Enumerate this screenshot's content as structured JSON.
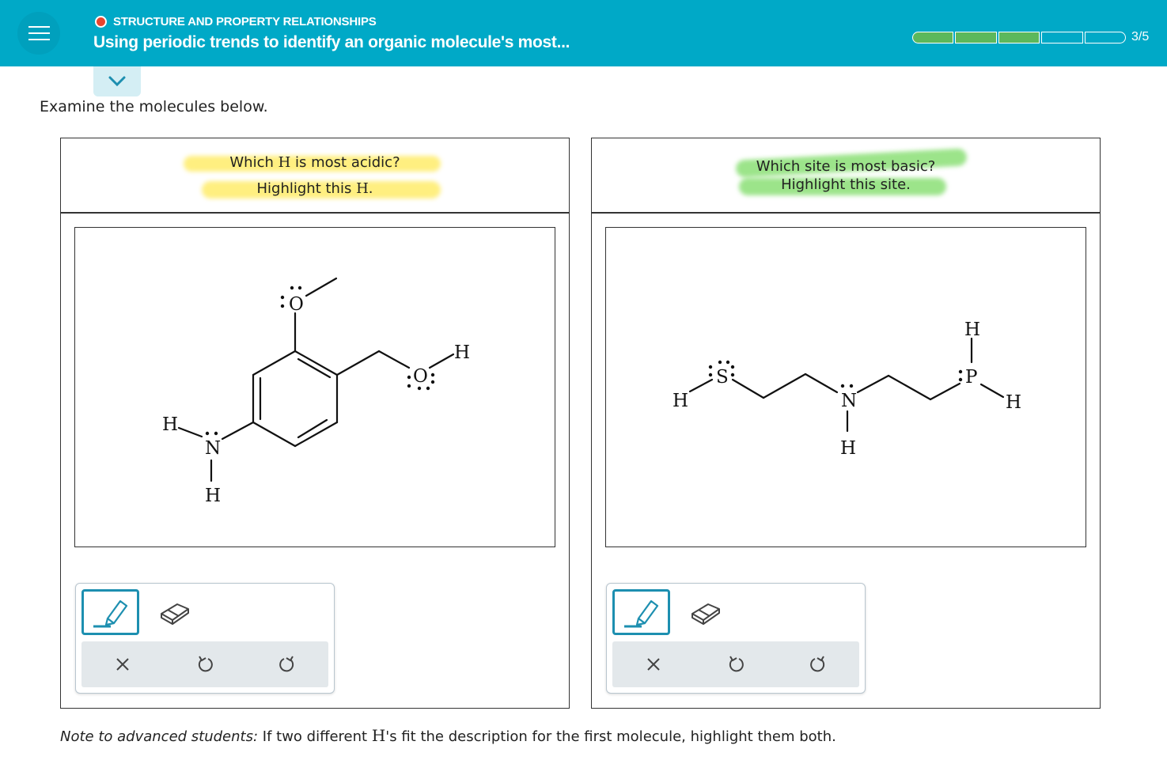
{
  "header": {
    "topic": "STRUCTURE AND PROPERTY RELATIONSHIPS",
    "title": "Using periodic trends to identify an organic molecule's most...",
    "progress_text": "3/5",
    "progress": {
      "completed": 3,
      "total": 5
    },
    "accent_color": "#00a9c7",
    "topic_dot_color": "#e8452f",
    "progress_fill_color": "#5cb85c"
  },
  "prompt": "Examine the molecules below.",
  "left_panel": {
    "question_line1_a": "Which ",
    "question_line1_b": "H",
    "question_line1_c": " is most acidic?",
    "question_line2_a": "Highlight this ",
    "question_line2_b": "H",
    "question_line2_c": ".",
    "highlight_color": "#ffe63c",
    "atoms": {
      "o_methoxy": "O",
      "o_hydroxyl": "O",
      "h_hydroxyl": "H",
      "n_amine": "N",
      "h_amine_left": "H",
      "h_amine_bottom": "H"
    }
  },
  "right_panel": {
    "question_line1": "Which site is most basic?",
    "question_line2": "Highlight this site.",
    "highlight_color": "#5ad23c",
    "atoms": {
      "h_thiol": "H",
      "s_thiol": "S",
      "n_amine": "N",
      "h_amine": "H",
      "p_phosphine": "P",
      "h_phos_top": "H",
      "h_phos_right": "H"
    }
  },
  "toolbox": {
    "icons": [
      "pen-icon",
      "eraser-icon",
      "close-icon",
      "undo-icon",
      "redo-icon"
    ]
  },
  "note": {
    "label": "Note to advanced students:",
    "text_a": " If two different ",
    "text_h": "H",
    "text_b": "'s fit the description for the first molecule, highlight them both."
  }
}
